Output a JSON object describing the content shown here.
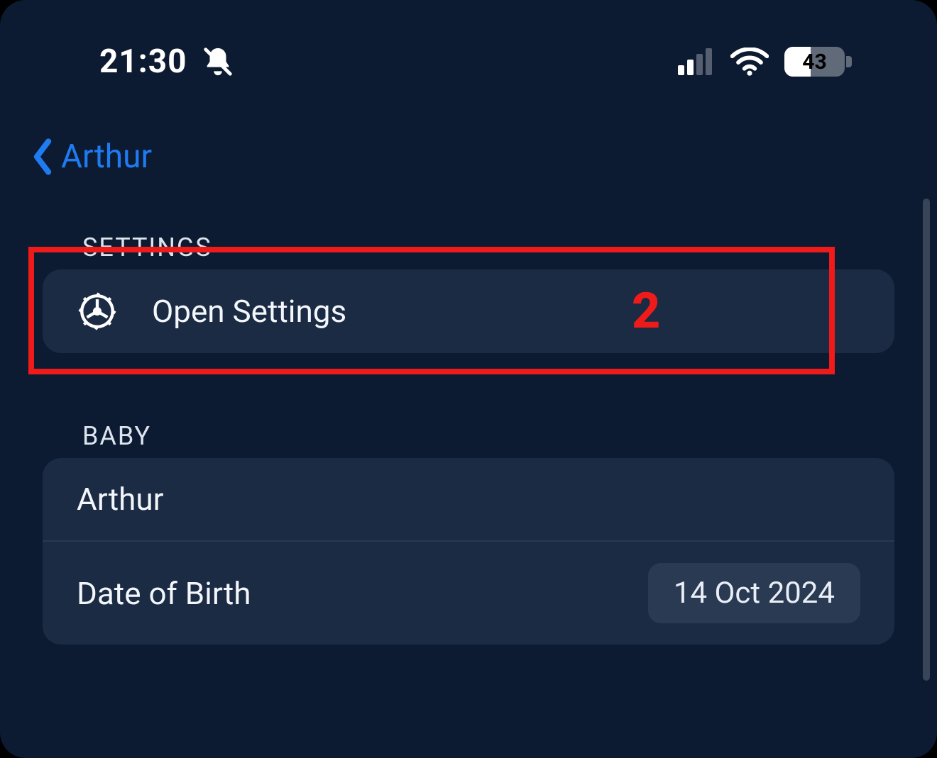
{
  "status": {
    "time": "21:30",
    "battery_percent": "43"
  },
  "nav": {
    "back_label": "Arthur"
  },
  "sections": {
    "settings": {
      "header": "SETTINGS",
      "open_settings_label": "Open Settings"
    },
    "baby": {
      "header": "BABY",
      "name_value": "Arthur",
      "dob_label": "Date of Birth",
      "dob_value": "14 Oct 2024"
    }
  },
  "annotation": {
    "number": "2"
  }
}
